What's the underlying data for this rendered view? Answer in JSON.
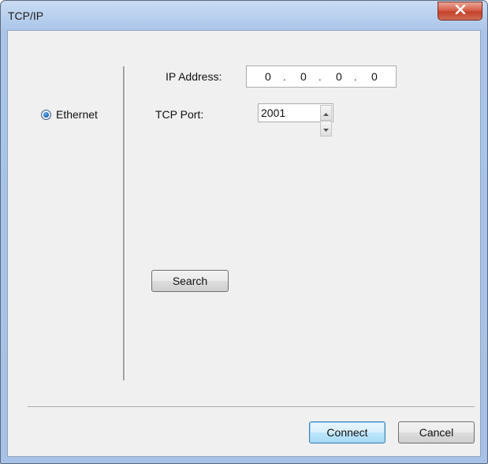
{
  "window": {
    "title": "TCP/IP"
  },
  "connection": {
    "ethernet_label": "Ethernet",
    "ethernet_selected": true
  },
  "ip": {
    "label": "IP Address:",
    "octets": [
      "0",
      "0",
      "0",
      "0"
    ],
    "separator": "."
  },
  "port": {
    "label": "TCP Port:",
    "value": "2001"
  },
  "buttons": {
    "search": "Search",
    "connect": "Connect",
    "cancel": "Cancel"
  },
  "icons": {
    "close": "close-icon",
    "spin_up": "chevron-up-icon",
    "spin_down": "chevron-down-icon"
  },
  "colors": {
    "title_bar": "#b9d0ee",
    "close_button": "#c4412b",
    "dialog_background": "#f0f0f0",
    "default_button": "#bee6fd"
  }
}
